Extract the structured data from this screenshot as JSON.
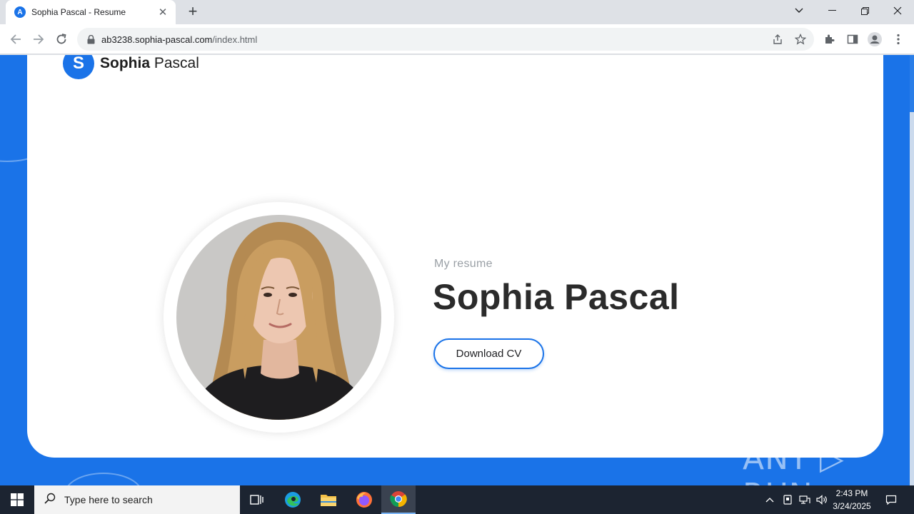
{
  "browser": {
    "tab": {
      "favicon_letter": "A",
      "title": "Sophia Pascal - Resume",
      "close": "✕"
    },
    "new_tab": "+",
    "url": {
      "domain": "ab3238.sophia-pascal.com",
      "path": "/index.html"
    }
  },
  "page": {
    "logo": {
      "mark": "S",
      "first": "Sophia",
      "last": " Pascal"
    },
    "subtitle": "My resume",
    "name": "Sophia Pascal",
    "download_button": "Download CV",
    "accent_color": "#1a73e8",
    "watermark": "ANY ▷ RUN"
  },
  "taskbar": {
    "search_placeholder": "Type here to search",
    "time": "2:43 PM",
    "date": "3/24/2025",
    "apps": [
      "task-view",
      "edge",
      "file-explorer",
      "firefox",
      "chrome"
    ]
  }
}
